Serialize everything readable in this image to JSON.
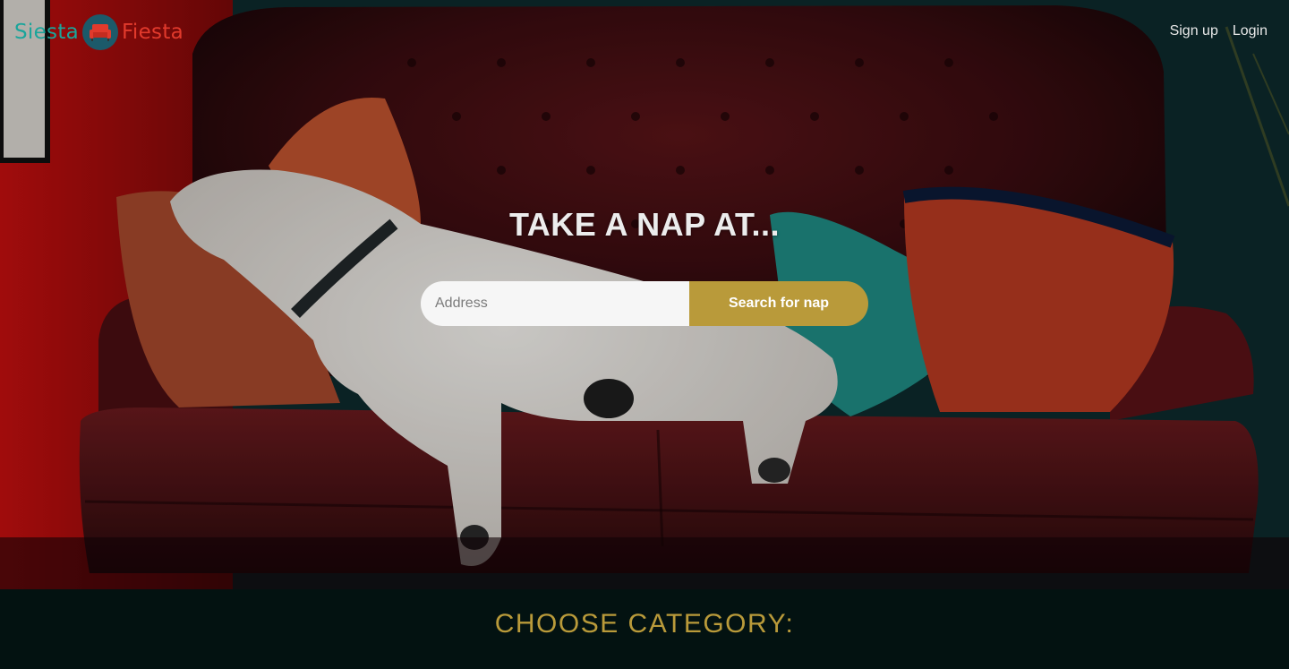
{
  "brand": {
    "left_word": "Siesta",
    "right_word": "Fiesta",
    "logo_icon": "sofa-icon"
  },
  "nav": {
    "signup_label": "Sign up",
    "login_label": "Login"
  },
  "hero": {
    "title": "TAKE A NAP AT...",
    "image_subject": "bulldog sleeping on a red leather tufted sofa"
  },
  "search": {
    "placeholder": "Address",
    "value": "",
    "button_label": "Search for nap"
  },
  "category": {
    "title": "CHOOSE CATEGORY:"
  },
  "colors": {
    "brand_teal": "#1aa59b",
    "brand_red": "#e23a2c",
    "accent_gold": "#b99a3a",
    "footer_bg": "#031211"
  }
}
